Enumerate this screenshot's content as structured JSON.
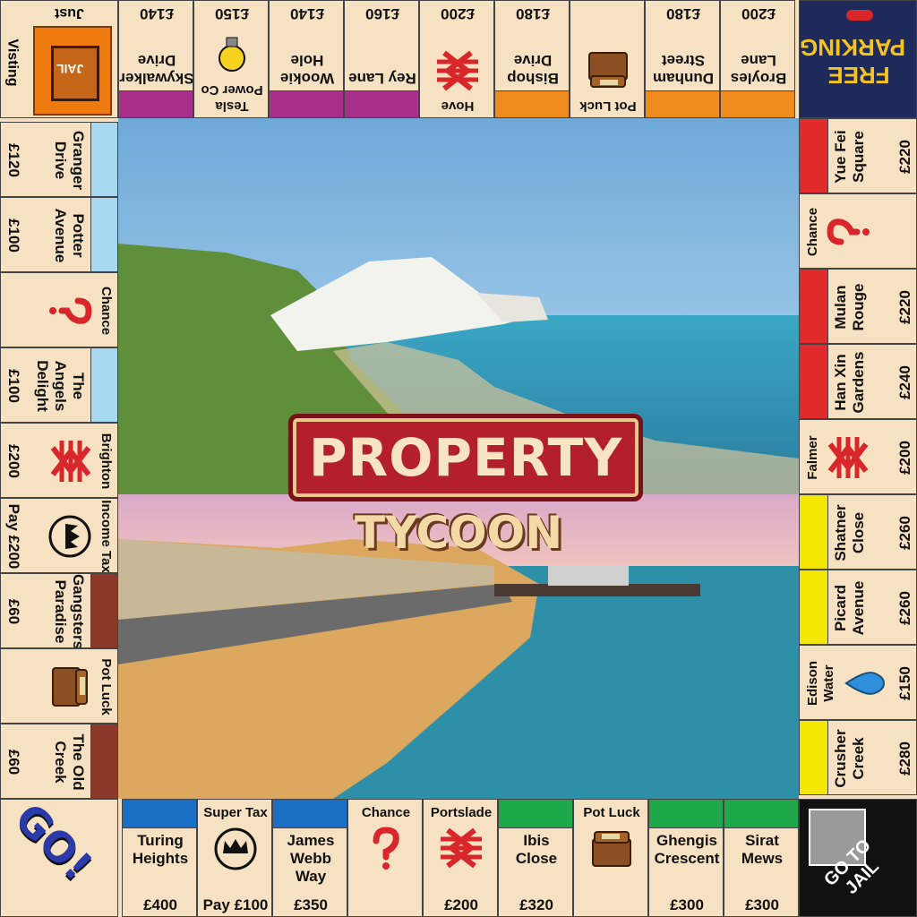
{
  "title": {
    "line1": "PROPERTY",
    "line2": "TYCOON"
  },
  "corners": {
    "go": {
      "label": "GO!"
    },
    "jail": {
      "top": "Just",
      "side": "Visting",
      "sign": "JAIL"
    },
    "free_parking": {
      "line1": "FREE",
      "line2": "PARKING"
    },
    "go_to_jail": {
      "line1": "GO TO",
      "line2": "JAIL"
    }
  },
  "bottom": [
    {
      "name": "Sirat Mews",
      "price": "£300",
      "color": "#1ea84a"
    },
    {
      "name": "Ghengis Crescent",
      "price": "£300",
      "color": "#1ea84a"
    },
    {
      "label": "Pot Luck",
      "icon": "chest-icon"
    },
    {
      "name": "Ibis Close",
      "price": "£320",
      "color": "#1ea84a"
    },
    {
      "label": "Portslade",
      "price": "£200",
      "icon": "rail-icon"
    },
    {
      "label": "Chance",
      "icon": "question-icon"
    },
    {
      "name": "James Webb Way",
      "price": "£350",
      "color": "#1b6fc4"
    },
    {
      "label": "Super Tax",
      "sub": "Pay £100",
      "icon": "crown-icon"
    },
    {
      "name": "Turing Heights",
      "price": "£400",
      "color": "#1b6fc4"
    }
  ],
  "left": [
    {
      "name": "The Old Creek",
      "price": "£60",
      "color": "#8b3a2a"
    },
    {
      "label": "Pot Luck",
      "icon": "chest-icon"
    },
    {
      "name": "Gangsters Paradise",
      "price": "£60",
      "color": "#8b3a2a"
    },
    {
      "label": "Income Tax",
      "sub": "Pay £200",
      "icon": "crown-icon"
    },
    {
      "label": "Brighton",
      "price": "£200",
      "icon": "rail-icon"
    },
    {
      "name": "The Angels Delight",
      "price": "£100",
      "color": "#a8d8f0"
    },
    {
      "label": "Chance",
      "icon": "question-icon"
    },
    {
      "name": "Potter Avenue",
      "price": "£100",
      "color": "#a8d8f0"
    },
    {
      "name": "Granger Drive",
      "price": "£120",
      "color": "#a8d8f0"
    }
  ],
  "top": [
    {
      "name": "Skywalker Drive",
      "price": "£140",
      "color": "#a8308a"
    },
    {
      "label": "Tesla Power Co",
      "price": "£150",
      "icon": "bulb-icon"
    },
    {
      "name": "Wookie Hole",
      "price": "£140",
      "color": "#a8308a"
    },
    {
      "name": "Rey Lane",
      "price": "£160",
      "color": "#a8308a"
    },
    {
      "label": "Hove",
      "price": "£200",
      "icon": "rail-icon"
    },
    {
      "name": "Bishop Drive",
      "price": "£180",
      "color": "#f08c1e"
    },
    {
      "label": "Pot Luck",
      "icon": "chest-icon"
    },
    {
      "name": "Dunham Street",
      "price": "£180",
      "color": "#f08c1e"
    },
    {
      "name": "Broyles Lane",
      "price": "£200",
      "color": "#f08c1e"
    }
  ],
  "right": [
    {
      "name": "Yue Fei Square",
      "price": "£220",
      "color": "#e32a2a"
    },
    {
      "label": "Chance",
      "icon": "question-icon"
    },
    {
      "name": "Mulan Rouge",
      "price": "£220",
      "color": "#e32a2a"
    },
    {
      "name": "Han Xin Gardens",
      "price": "£240",
      "color": "#e32a2a"
    },
    {
      "label": "Falmer",
      "price": "£200",
      "icon": "rail-icon"
    },
    {
      "name": "Shatner Close",
      "price": "£260",
      "color": "#f3e600"
    },
    {
      "name": "Picard Avenue",
      "price": "£260",
      "color": "#f3e600"
    },
    {
      "label": "Edison Water",
      "price": "£150",
      "icon": "water-drop-icon"
    },
    {
      "name": "Crusher Creek",
      "price": "£280",
      "color": "#f3e600"
    }
  ]
}
